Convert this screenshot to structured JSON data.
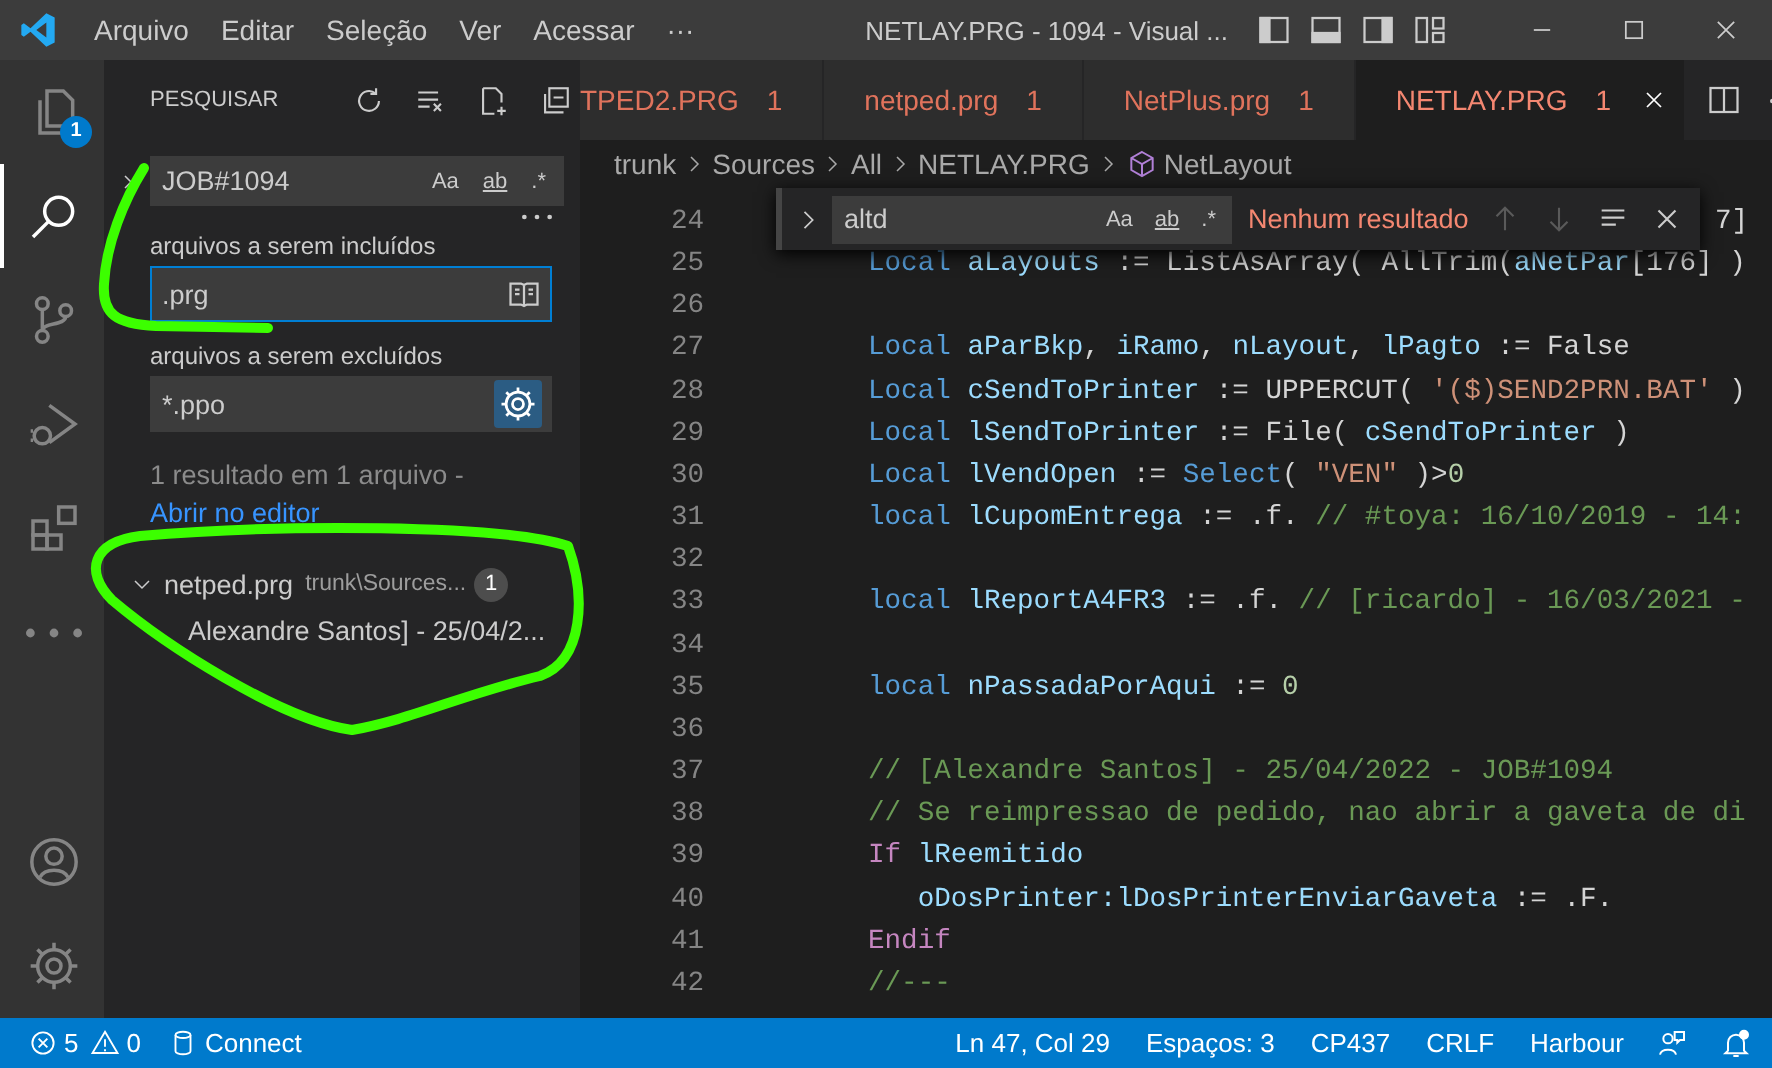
{
  "title_bar": {
    "menus": [
      "Arquivo",
      "Editar",
      "Seleção",
      "Ver",
      "Acessar",
      "···"
    ],
    "title": "NETLAY.PRG - 1094 - Visual ..."
  },
  "activity_bar": {
    "items": [
      {
        "kind": "explorer",
        "selected": false,
        "badge": "1"
      },
      {
        "kind": "search",
        "selected": true
      },
      {
        "kind": "source-control",
        "selected": false
      },
      {
        "kind": "run-debug",
        "selected": false
      },
      {
        "kind": "extensions",
        "selected": false
      },
      {
        "kind": "more",
        "selected": false
      }
    ],
    "bottom": [
      {
        "kind": "account"
      },
      {
        "kind": "settings"
      }
    ]
  },
  "sidebar": {
    "title": "PESQUISAR",
    "search": {
      "value": "JOB#1094",
      "replace_expanded": false,
      "options": [
        {
          "label": "Aa",
          "on": false
        },
        {
          "label": "ab",
          "on": false
        },
        {
          "label": ".*",
          "on": false
        }
      ]
    },
    "include": {
      "label": "arquivos a serem incluídos",
      "value": ".prg",
      "focused": true
    },
    "exclude": {
      "label": "arquivos a serem excluídos",
      "value": "*.ppo",
      "use_exclude_settings": true
    },
    "summary": "1 resultado em 1 arquivo -",
    "open_link": "Abrir no editor",
    "results": [
      {
        "file": "netped.prg",
        "path": "trunk\\Sources...",
        "count": "1",
        "expanded": true,
        "children": [
          {
            "text": "Alexandre Santos] - 25/04/2..."
          }
        ]
      }
    ]
  },
  "editor": {
    "tabs": [
      {
        "label": "TPED2.PRG",
        "problems": "1",
        "selected": false
      },
      {
        "label": "netped.prg",
        "problems": "1",
        "selected": false
      },
      {
        "label": "NetPlus.prg",
        "problems": "1",
        "selected": false
      },
      {
        "label": "NETLAY.PRG",
        "problems": "1",
        "selected": true
      }
    ],
    "breadcrumb": [
      {
        "text": "trunk",
        "kind": "folder"
      },
      {
        "text": "Sources",
        "kind": "folder"
      },
      {
        "text": "All",
        "kind": "folder"
      },
      {
        "text": "NETLAY.PRG",
        "kind": "file"
      },
      {
        "text": "NetLayout",
        "kind": "symbol"
      }
    ],
    "find": {
      "value": "altd",
      "options": [
        {
          "label": "Aa",
          "on": false
        },
        {
          "label": "ab",
          "on": false
        },
        {
          "label": ".*",
          "on": false
        }
      ],
      "result": "Nenhum resultado"
    },
    "lines": [
      {
        "number": "24",
        "tokens": [
          {
            "kind": "plain",
            "text": "7]"
          }
        ]
      },
      {
        "number": "25",
        "tokens": [
          {
            "kind": "keyword",
            "text": "Local "
          },
          {
            "kind": "variable",
            "text": "aLayouts"
          },
          {
            "kind": "plain",
            "text": " := ListAsArray( AllTrim("
          },
          {
            "kind": "variable",
            "text": "aNetPar"
          },
          {
            "kind": "plain",
            "text": "[176] )"
          }
        ]
      },
      {
        "number": "26"
      },
      {
        "number": "27",
        "tokens": [
          {
            "kind": "keyword",
            "text": "Local "
          },
          {
            "kind": "variable",
            "text": "aParBkp"
          },
          {
            "kind": "plain",
            "text": ", "
          },
          {
            "kind": "variable",
            "text": "iRamo"
          },
          {
            "kind": "plain",
            "text": ", "
          },
          {
            "kind": "variable",
            "text": "nLayout"
          },
          {
            "kind": "plain",
            "text": ", "
          },
          {
            "kind": "variable",
            "text": "lPagto"
          },
          {
            "kind": "plain",
            "text": " := False"
          }
        ]
      },
      {
        "number": "28",
        "tokens": [
          {
            "kind": "keyword",
            "text": "Local "
          },
          {
            "kind": "variable",
            "text": "cSendToPrinter"
          },
          {
            "kind": "plain",
            "text": " := UPPERCUT( "
          },
          {
            "kind": "string",
            "text": "'($)SEND2PRN.BAT'"
          },
          {
            "kind": "plain",
            "text": " )"
          }
        ]
      },
      {
        "number": "29",
        "tokens": [
          {
            "kind": "keyword",
            "text": "Local "
          },
          {
            "kind": "variable",
            "text": "lSendToPrinter"
          },
          {
            "kind": "plain",
            "text": " := File( "
          },
          {
            "kind": "variable",
            "text": "cSendToPrinter"
          },
          {
            "kind": "plain",
            "text": " )"
          }
        ]
      },
      {
        "number": "30",
        "tokens": [
          {
            "kind": "keyword",
            "text": "Local "
          },
          {
            "kind": "variable",
            "text": "lVendOpen"
          },
          {
            "kind": "plain",
            "text": " := "
          },
          {
            "kind": "function",
            "text": "Select"
          },
          {
            "kind": "plain",
            "text": "( "
          },
          {
            "kind": "string",
            "text": "\"VEN\""
          },
          {
            "kind": "plain",
            "text": " )>"
          },
          {
            "kind": "number",
            "text": "0"
          }
        ]
      },
      {
        "number": "31",
        "tokens": [
          {
            "kind": "keyword",
            "text": "local "
          },
          {
            "kind": "variable",
            "text": "lCupomEntrega"
          },
          {
            "kind": "plain",
            "text": " := .f. "
          },
          {
            "kind": "comment",
            "text": "// #toya: 16/10/2019 - 14:"
          }
        ]
      },
      {
        "number": "32"
      },
      {
        "number": "33",
        "tokens": [
          {
            "kind": "keyword",
            "text": "local "
          },
          {
            "kind": "variable",
            "text": "lReportA4FR3"
          },
          {
            "kind": "plain",
            "text": " := .f. "
          },
          {
            "kind": "comment",
            "text": "// [ricardo] - 16/03/2021 -"
          }
        ]
      },
      {
        "number": "34"
      },
      {
        "number": "35",
        "tokens": [
          {
            "kind": "keyword",
            "text": "local "
          },
          {
            "kind": "variable",
            "text": "nPassadaPorAqui"
          },
          {
            "kind": "plain",
            "text": " := "
          },
          {
            "kind": "number",
            "text": "0"
          }
        ]
      },
      {
        "number": "36"
      },
      {
        "number": "37",
        "tokens": [
          {
            "kind": "comment",
            "text": "// [Alexandre Santos] - 25/04/2022 - JOB#1094"
          }
        ]
      },
      {
        "number": "38",
        "tokens": [
          {
            "kind": "comment",
            "text": "// Se reimpressao de pedido, nao abrir a gaveta de di"
          }
        ]
      },
      {
        "number": "39",
        "tokens": [
          {
            "kind": "control",
            "text": "If "
          },
          {
            "kind": "variable",
            "text": "lReemitido"
          }
        ]
      },
      {
        "number": "40",
        "tokens": [
          {
            "kind": "variable",
            "text": "   oDosPrinter:lDosPrinterEnviarGaveta"
          },
          {
            "kind": "plain",
            "text": " := .F."
          }
        ]
      },
      {
        "number": "41",
        "tokens": [
          {
            "kind": "control",
            "text": "Endif"
          }
        ]
      },
      {
        "number": "42",
        "tokens": [
          {
            "kind": "comment",
            "text": "//---"
          }
        ]
      }
    ]
  },
  "status_bar": {
    "left": [
      {
        "kind": "errors",
        "text": "5"
      },
      {
        "kind": "warnings",
        "text": "0"
      },
      {
        "kind": "database",
        "text": "Connect"
      }
    ],
    "right": [
      {
        "kind": "text",
        "text": "Ln 47, Col 29"
      },
      {
        "kind": "text",
        "text": "Espaços: 3"
      },
      {
        "kind": "text",
        "text": "CP437"
      },
      {
        "kind": "text",
        "text": "CRLF"
      },
      {
        "kind": "text",
        "text": "Harbour"
      },
      {
        "kind": "feedback"
      },
      {
        "kind": "bell"
      }
    ]
  }
}
